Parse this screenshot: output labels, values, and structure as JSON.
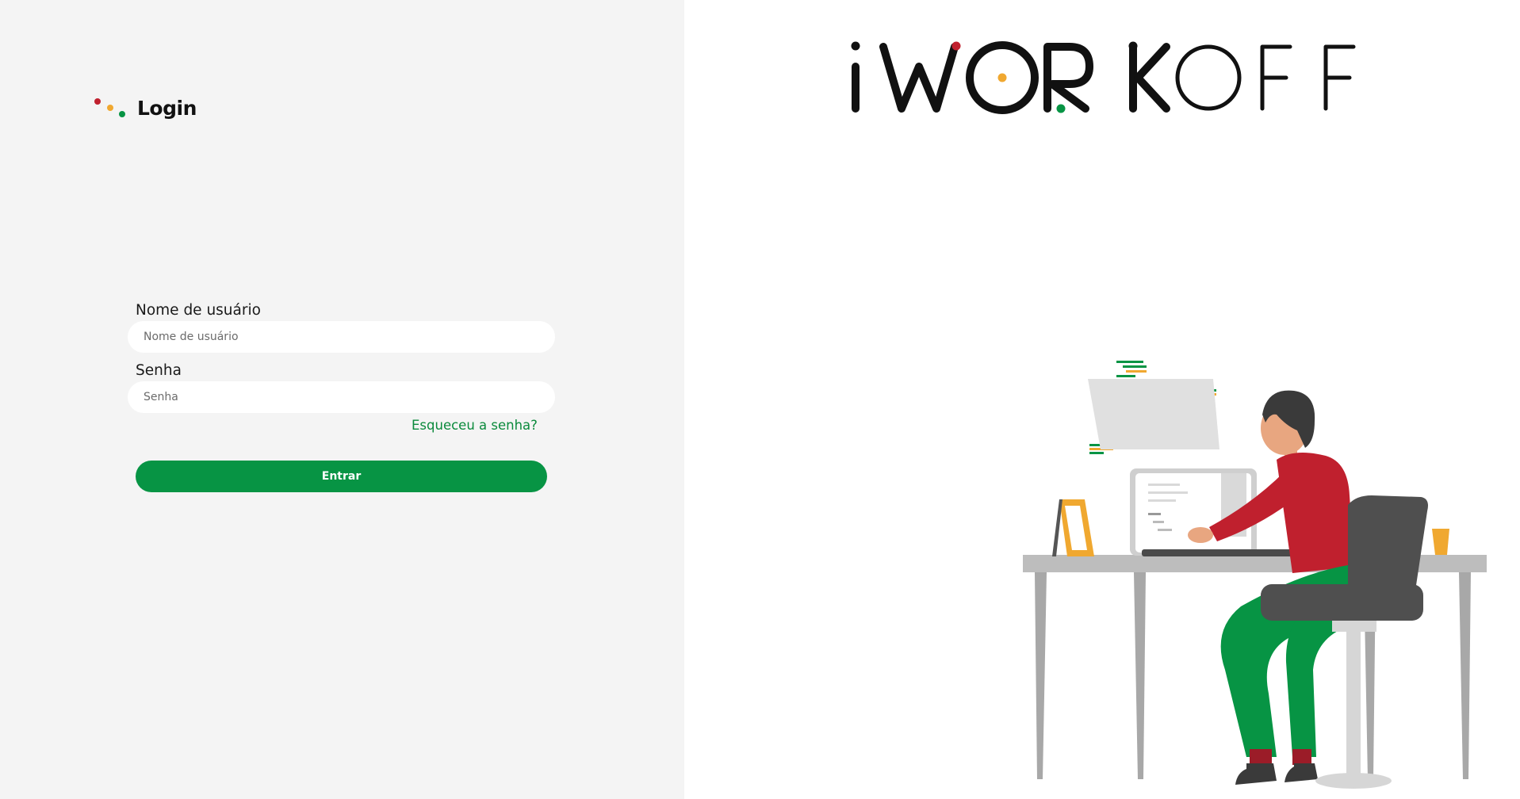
{
  "colors": {
    "brand_red": "#c0202e",
    "brand_orange": "#f0a830",
    "brand_green": "#079444",
    "left_bg": "#f4f4f4",
    "text_dark": "#111111"
  },
  "login": {
    "title": "Login",
    "username_label": "Nome de usuário",
    "username_placeholder": "Nome de usuário",
    "username_value": "",
    "password_label": "Senha",
    "password_placeholder": "Senha",
    "password_value": "",
    "forgot_link": "Esqueceu a senha?",
    "submit_label": "Entrar"
  },
  "brand": {
    "logo_text": "iWORKOFF"
  },
  "icons": {
    "login_icon": "three-colored-dots-icon",
    "illustration": "person-working-at-laptop-illustration"
  }
}
